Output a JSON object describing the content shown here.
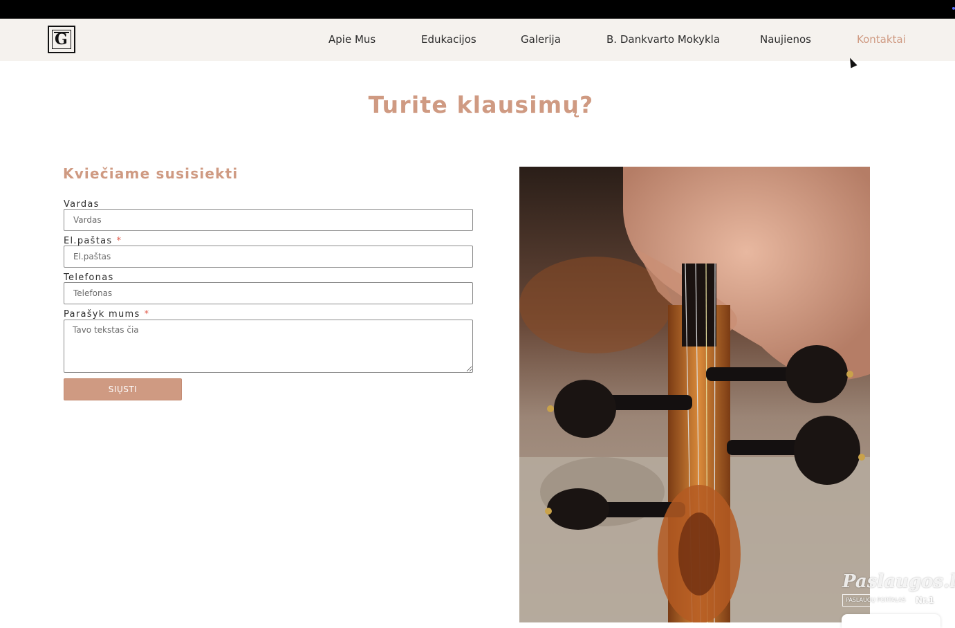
{
  "nav": {
    "logo_letter": "G",
    "items": [
      {
        "label": "Apie Mus"
      },
      {
        "label": "Edukacijos"
      },
      {
        "label": "Galerija"
      },
      {
        "label": "B. Dankvarto Mokykla"
      },
      {
        "label": "Naujienos"
      },
      {
        "label": "Kontaktai",
        "active": true
      }
    ]
  },
  "page": {
    "title": "Turite klausimų?"
  },
  "form": {
    "heading": "Kviečiame susisiekti",
    "name": {
      "label": "Vardas",
      "placeholder": "Vardas",
      "value": ""
    },
    "email": {
      "label": "El.paštas",
      "required_mark": "*",
      "placeholder": "El.paštas",
      "value": ""
    },
    "phone": {
      "label": "Telefonas",
      "placeholder": "Telefonas",
      "value": ""
    },
    "message": {
      "label": "Parašyk mums",
      "required_mark": "*",
      "placeholder": "Tavo tekstas čia",
      "value": ""
    },
    "submit_label": "SIŲSTI"
  },
  "badge": {
    "brand": "Paslaugos.lt",
    "tagline": "PASLAUGŲ PORTALAS",
    "rank": "Nr.1"
  },
  "colors": {
    "accent": "#cf9a82",
    "nav_background": "#f5f2ee",
    "top_bar": "#000000",
    "required": "#e05a4a"
  },
  "icons": {
    "logo": "tg-monogram-logo",
    "cursor": "mouse-pointer-icon",
    "photo": "violin-scroll-pegbox-photo"
  }
}
